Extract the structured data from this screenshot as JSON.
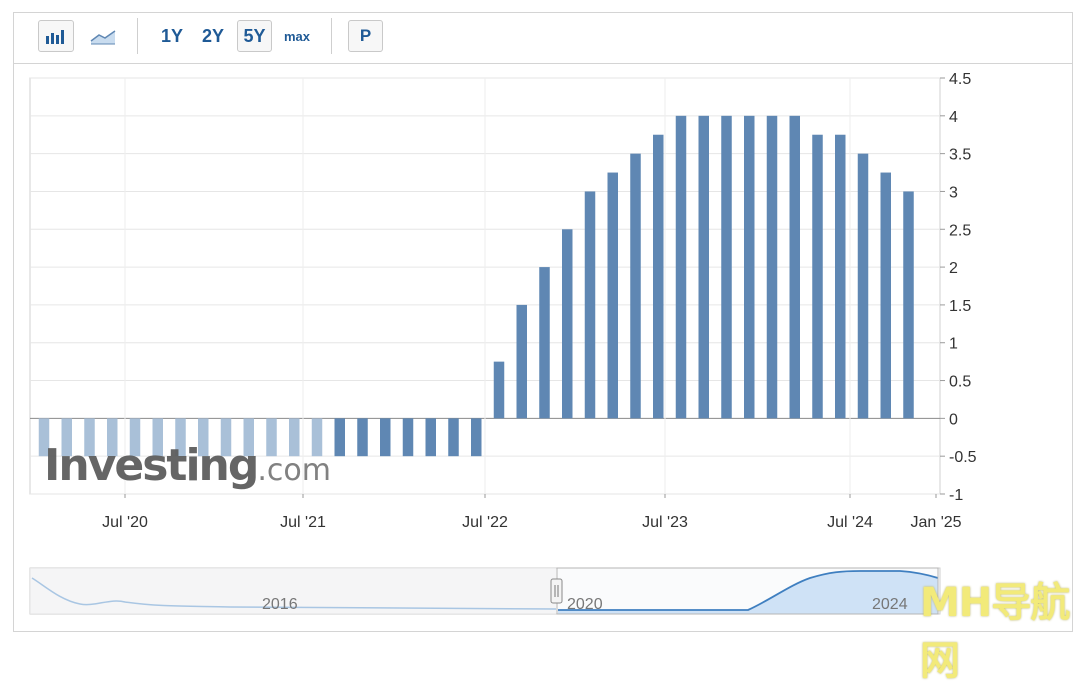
{
  "toolbar": {
    "bar_icon": "bar-chart-icon",
    "line_icon": "line-chart-icon",
    "ranges": [
      "1Y",
      "2Y",
      "5Y",
      "max"
    ],
    "active_range": "5Y",
    "p_label": "P"
  },
  "chart_data": {
    "type": "bar",
    "title": "",
    "ylim": [
      -1,
      4.5
    ],
    "yticks": [
      "4.5",
      "4",
      "3.5",
      "3",
      "2.5",
      "2",
      "1.5",
      "1",
      "0.5",
      "0",
      "-0.5",
      "-1"
    ],
    "xticks": [
      "Jul '20",
      "Jul '21",
      "Jul '22",
      "Jul '23",
      "Jul '24",
      "Jan '25"
    ],
    "values": [
      -0.5,
      -0.5,
      -0.5,
      -0.5,
      -0.5,
      -0.5,
      -0.5,
      -0.5,
      -0.5,
      -0.5,
      -0.5,
      -0.5,
      -0.5,
      -0.5,
      -0.5,
      -0.5,
      -0.5,
      -0.5,
      -0.5,
      -0.5,
      0.75,
      1.5,
      2.0,
      2.5,
      3.0,
      3.25,
      3.5,
      3.75,
      4.0,
      4.0,
      4.0,
      4.0,
      4.0,
      4.0,
      3.75,
      3.75,
      3.5,
      3.25,
      3.0
    ],
    "grid": true,
    "bar_color": "#5f87b3",
    "faded_bar_color": "#a9c0d8"
  },
  "navigator": {
    "labels": [
      "2016",
      "2020",
      "2024"
    ],
    "fill_color": "#cfe2f6",
    "line_color": "#3f7fc0"
  },
  "watermark": {
    "brand": "Investing",
    "suffix": ".com",
    "overlay": "MH导航网"
  }
}
